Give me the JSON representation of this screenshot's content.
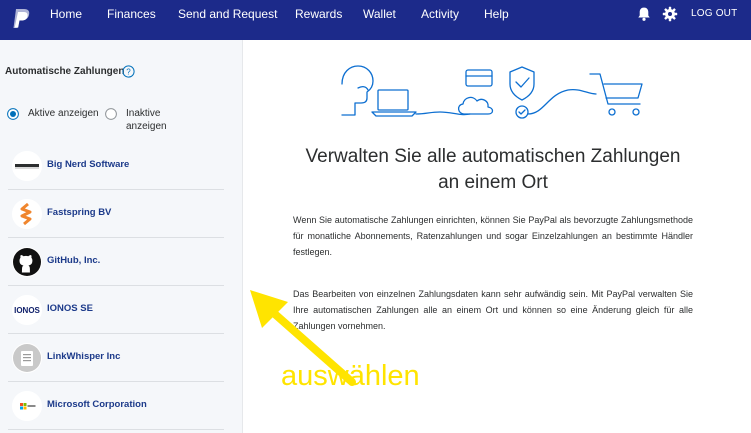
{
  "nav": {
    "items": [
      "Home",
      "Finances",
      "Send and Request",
      "Rewards",
      "Wallet",
      "Activity",
      "Help"
    ],
    "logout": "LOG OUT",
    "brand_color": "#1c2a8a"
  },
  "sidebar": {
    "title": "Automatische Zahlungen",
    "filters": [
      {
        "label": "Aktive anzeigen",
        "selected": true
      },
      {
        "label": "Inaktive anzeigen",
        "selected": false
      }
    ],
    "merchants": [
      {
        "name": "Big Nerd Software",
        "icon": "big-nerd-logo"
      },
      {
        "name": "Fastspring BV",
        "icon": "fastspring-logo"
      },
      {
        "name": "GitHub, Inc.",
        "icon": "github-logo"
      },
      {
        "name": "IONOS SE",
        "icon": "ionos-logo"
      },
      {
        "name": "LinkWhisper Inc",
        "icon": "linkwhisper-logo"
      },
      {
        "name": "Microsoft Corporation",
        "icon": "microsoft-logo"
      }
    ]
  },
  "main": {
    "title": "Verwalten Sie alle automatischen Zahlungen\nan einem Ort",
    "paragraph1": "Wenn Sie automatische Zahlungen einrichten, können Sie PayPal als bevorzugte Zahlungsmethode für monatliche Abonnements, Ratenzahlungen und sogar Einzelzahlungen an bestimmte Händler festlegen.",
    "paragraph2": "Das Bearbeiten von einzelnen Zahlungsdaten kann sehr aufwändig sein. Mit PayPal verwalten Sie Ihre automatischen Zahlungen alle an einem Ort und können so eine Änderung gleich für alle Zahlungen vornehmen."
  },
  "annotation": {
    "text": "auswählen",
    "color": "#ffe400"
  }
}
